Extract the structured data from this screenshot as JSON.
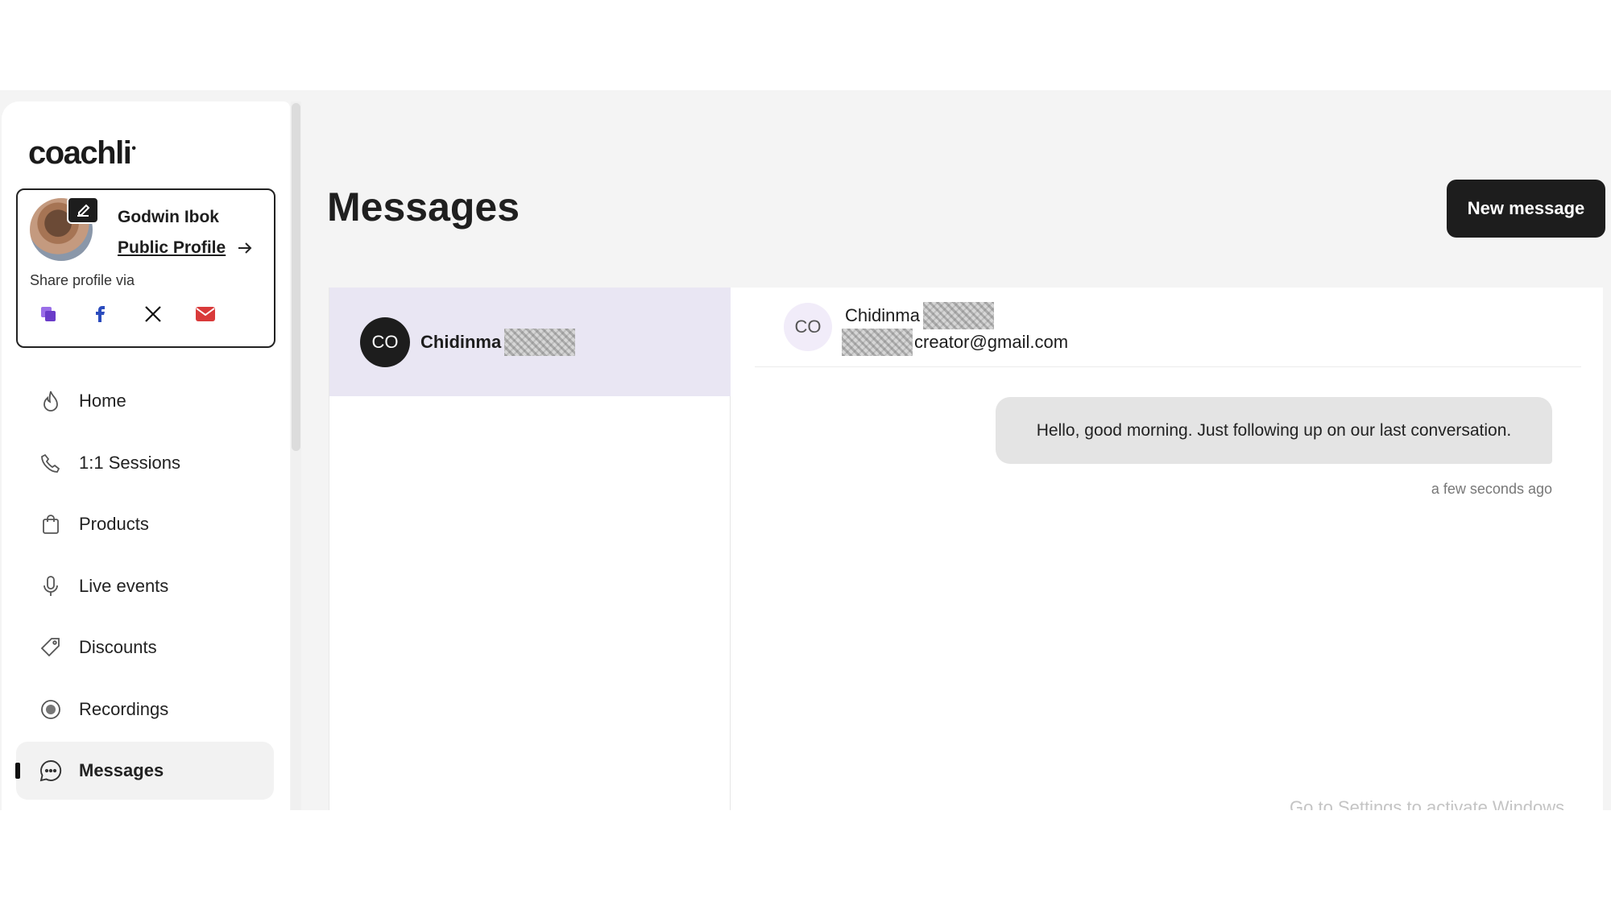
{
  "app": {
    "logo": "coachli"
  },
  "profile": {
    "name": "Godwin Ibok",
    "public_profile_label": "Public Profile",
    "share_label": "Share profile via",
    "share_icons": [
      "copy-link-icon",
      "facebook-icon",
      "x-icon",
      "email-icon"
    ]
  },
  "nav": {
    "items": [
      {
        "label": "Home",
        "icon": "flame-icon"
      },
      {
        "label": "1:1 Sessions",
        "icon": "phone-icon"
      },
      {
        "label": "Products",
        "icon": "bag-icon"
      },
      {
        "label": "Live events",
        "icon": "microphone-icon"
      },
      {
        "label": "Discounts",
        "icon": "tag-icon"
      },
      {
        "label": "Recordings",
        "icon": "record-icon"
      },
      {
        "label": "Messages",
        "icon": "chat-icon",
        "active": true
      }
    ]
  },
  "main": {
    "title": "Messages",
    "new_message_label": "New message"
  },
  "conversations": [
    {
      "initials": "CO",
      "name": "Chidinma",
      "selected": true
    }
  ],
  "chat": {
    "initials": "CO",
    "name": "Chidinma",
    "email": "creator@gmail.com",
    "messages": [
      {
        "text": "Hello, good morning. Just following up on our last conversation.",
        "time": "a few seconds ago"
      }
    ]
  },
  "os_watermark": "Go to Settings to activate Windows",
  "colors": {
    "accent_dark": "#1d1d1d",
    "selected_conversation": "#e9e6f3",
    "background": "#f4f4f4"
  }
}
